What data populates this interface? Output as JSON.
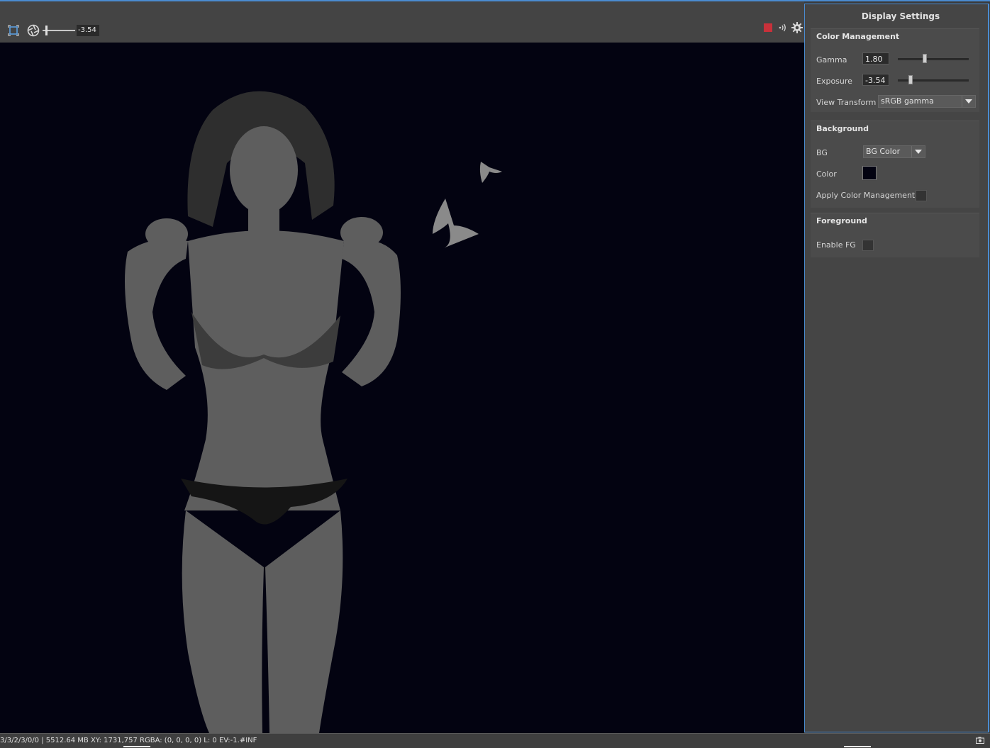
{
  "toolbar": {
    "exposure_value": "-3.54",
    "exposure_level": 0.12,
    "icons": [
      "frame-icon",
      "exposure-icon",
      "stop-render-icon",
      "sound-icon",
      "settings-icon"
    ],
    "stop_color": "#c8313a"
  },
  "viewport": {
    "background_color": "#030311",
    "content": "render-image"
  },
  "panel": {
    "title": "Display Settings",
    "accent_color": "#4a8bd0",
    "color_management": {
      "title": "Color Management",
      "gamma_label": "Gamma",
      "gamma_value": "1.80",
      "gamma_level": 0.38,
      "exposure_label": "Exposure",
      "exposure_value": "-3.54",
      "exposure_level": 0.18,
      "view_transform_label": "View Transform",
      "view_transform_value": "sRGB gamma"
    },
    "background": {
      "title": "Background",
      "bg_label": "BG",
      "bg_value": "BG Color",
      "color_label": "Color",
      "color_value": "#030311",
      "apply_cm_label": "Apply Color Management",
      "apply_cm_checked": false
    },
    "foreground": {
      "title": "Foreground",
      "enable_fg_label": "Enable FG",
      "enable_fg_checked": false
    }
  },
  "statusbar": {
    "text": "3/3/2/3/0/0 | 5512.64 MB XY: 1731,757 RGBA: (0, 0, 0, 0)  L: 0 EV:-1.#INF"
  }
}
